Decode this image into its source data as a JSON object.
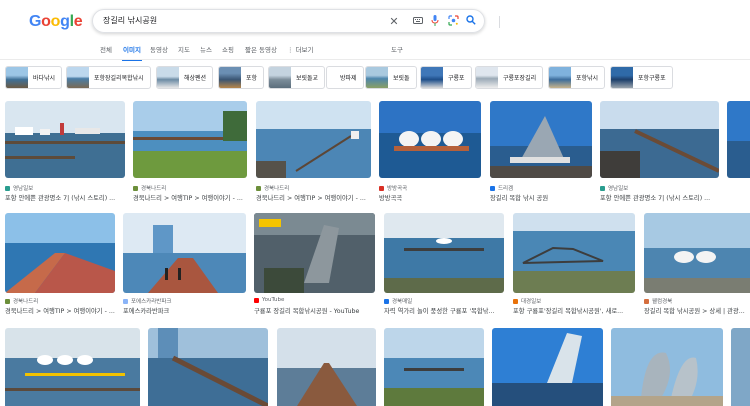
{
  "logo": {
    "text": "Google"
  },
  "search": {
    "query": "장길리 낚시공원"
  },
  "tabs": [
    {
      "label": "전체",
      "active": false
    },
    {
      "label": "이미지",
      "active": true
    },
    {
      "label": "동영상",
      "active": false
    },
    {
      "label": "지도",
      "active": false
    },
    {
      "label": "뉴스",
      "active": false
    },
    {
      "label": "쇼핑",
      "active": false
    },
    {
      "label": "짧은 동영상",
      "active": false
    },
    {
      "label": "⋮ 더보기",
      "active": false
    },
    {
      "label": "도구",
      "active": false
    }
  ],
  "chips": [
    {
      "label": "바다낚시"
    },
    {
      "label": "포항장길리복합낚시"
    },
    {
      "label": "해상펜션"
    },
    {
      "label": "포항"
    },
    {
      "label": "보릿돌교"
    },
    {
      "label": "방파제"
    },
    {
      "label": "보릿돌"
    },
    {
      "label": "구룡포"
    },
    {
      "label": "구룡포장길리"
    },
    {
      "label": "포항낚시"
    },
    {
      "label": "포항구룡포"
    }
  ],
  "row1": [
    {
      "source": "영남일보",
      "caption": "포항 안에쁜 관광명소 7| (낚시 스토리) ..."
    },
    {
      "source": "경북나드리",
      "caption": "경북나드리 > 여행TIP > 여행이야기 - ..."
    },
    {
      "source": "경북나드리",
      "caption": "경북나드리 > 여행TIP > 여행이야기 - ..."
    },
    {
      "source": "방방곡곡",
      "caption": "방방곡곡"
    },
    {
      "source": "드리겜",
      "caption": "장길리 복합 낚시 공원"
    },
    {
      "source": "영남일보",
      "caption": "포항 안에쁜 관광명소 7| (낚시 스토리) ..."
    }
  ],
  "row2": [
    {
      "source": "경북나드리",
      "caption": "경북나드리 > 여행TIP > 여행이야기 - ..."
    },
    {
      "source": "포에스카라반파크",
      "caption": "포에스카라반파크"
    },
    {
      "source": "YouTube",
      "caption": "구룡포 장길리 복합낚시공원 - YouTube"
    },
    {
      "source": "경북매일",
      "caption": "자력 역가리 놀이 풍성한 구룡포 '복합낚..."
    },
    {
      "source": "대경일보",
      "caption": "포항 구룡포'장길리 복합낚시공원', 새로..."
    },
    {
      "source": "웰컴경북",
      "caption": "장길리 복합 낚시공원 > 상세 | 관광..."
    }
  ],
  "colors": {
    "accent": "#1a73e8",
    "google_blue": "#4285f4",
    "google_red": "#ea4335",
    "google_yellow": "#fbbc05",
    "google_green": "#34a853"
  },
  "icons": {
    "clear": "close-icon",
    "keyboard": "keyboard-icon",
    "voice": "microphone-icon",
    "lens": "camera-lens-icon",
    "search": "search-icon"
  }
}
